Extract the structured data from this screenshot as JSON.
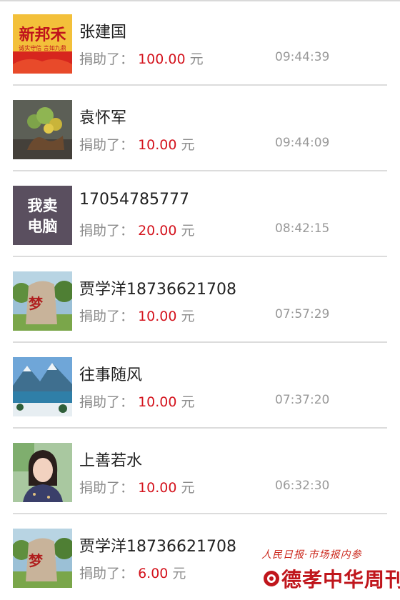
{
  "donations": [
    {
      "name": "张建国",
      "label": "捐助了：",
      "amount": "100.00",
      "unit": "元",
      "time": "09:44:39",
      "avatar": {
        "icon": "xinbanghe-logo",
        "text_main": "新邦禾",
        "text_sub": "诚实守信  言如九鼎"
      }
    },
    {
      "name": "袁怀军",
      "label": "捐助了：",
      "amount": "10.00",
      "unit": "元",
      "time": "09:44:09",
      "avatar": {
        "icon": "bonsai-photo"
      }
    },
    {
      "name": "17054785777",
      "label": "捐助了：",
      "amount": "20.00",
      "unit": "元",
      "time": "08:42:15",
      "avatar": {
        "icon": "text-avatar",
        "line1": "我卖",
        "line2": "电脑"
      }
    },
    {
      "name": "贾学洋18736621708",
      "label": "捐助了：",
      "amount": "10.00",
      "unit": "元",
      "time": "07:57:29",
      "avatar": {
        "icon": "dream-stone-photo",
        "text": "梦"
      }
    },
    {
      "name": "往事随风",
      "label": "捐助了：",
      "amount": "10.00",
      "unit": "元",
      "time": "07:37:20",
      "avatar": {
        "icon": "lake-landscape-photo"
      }
    },
    {
      "name": "上善若水",
      "label": "捐助了：",
      "amount": "10.00",
      "unit": "元",
      "time": "06:32:30",
      "avatar": {
        "icon": "woman-portrait-photo"
      }
    },
    {
      "name": "贾学洋18736621708",
      "label": "捐助了：",
      "amount": "6.00",
      "unit": "元",
      "time": "",
      "avatar": {
        "icon": "dream-stone-photo",
        "text": "梦"
      }
    }
  ],
  "watermark": {
    "top": "人民日报·市场报内参",
    "main": "德孝中华周刊"
  },
  "colors": {
    "amount": "#d4141e",
    "label": "#8c8c8c",
    "divider": "#dcdcdc"
  }
}
